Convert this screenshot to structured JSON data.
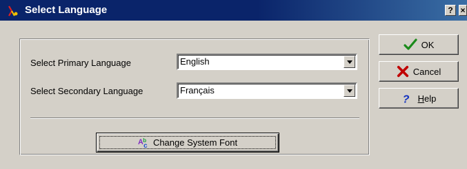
{
  "window": {
    "title": "Select Language",
    "help_glyph": "?",
    "close_glyph": "×",
    "app_icon": "language-app-icon"
  },
  "form": {
    "primary_label": "Select Primary Language",
    "primary_value": "English",
    "secondary_label": "Select Secondary Language",
    "secondary_value": "Français",
    "change_font_label": "Change System Font"
  },
  "buttons": {
    "ok": "OK",
    "cancel": "Cancel",
    "help_prefix": "",
    "help_accel": "H",
    "help_rest": "elp"
  },
  "colors": {
    "titlebar": "#0a246a",
    "face": "#d4d0c8",
    "ok_check": "#1a8a1a",
    "cancel_x": "#c00000",
    "help_q": "#1030c0"
  },
  "icons": {
    "ok": "checkmark-icon",
    "cancel": "red-x-icon",
    "help": "question-mark-icon",
    "font": "font-ab-icon"
  }
}
